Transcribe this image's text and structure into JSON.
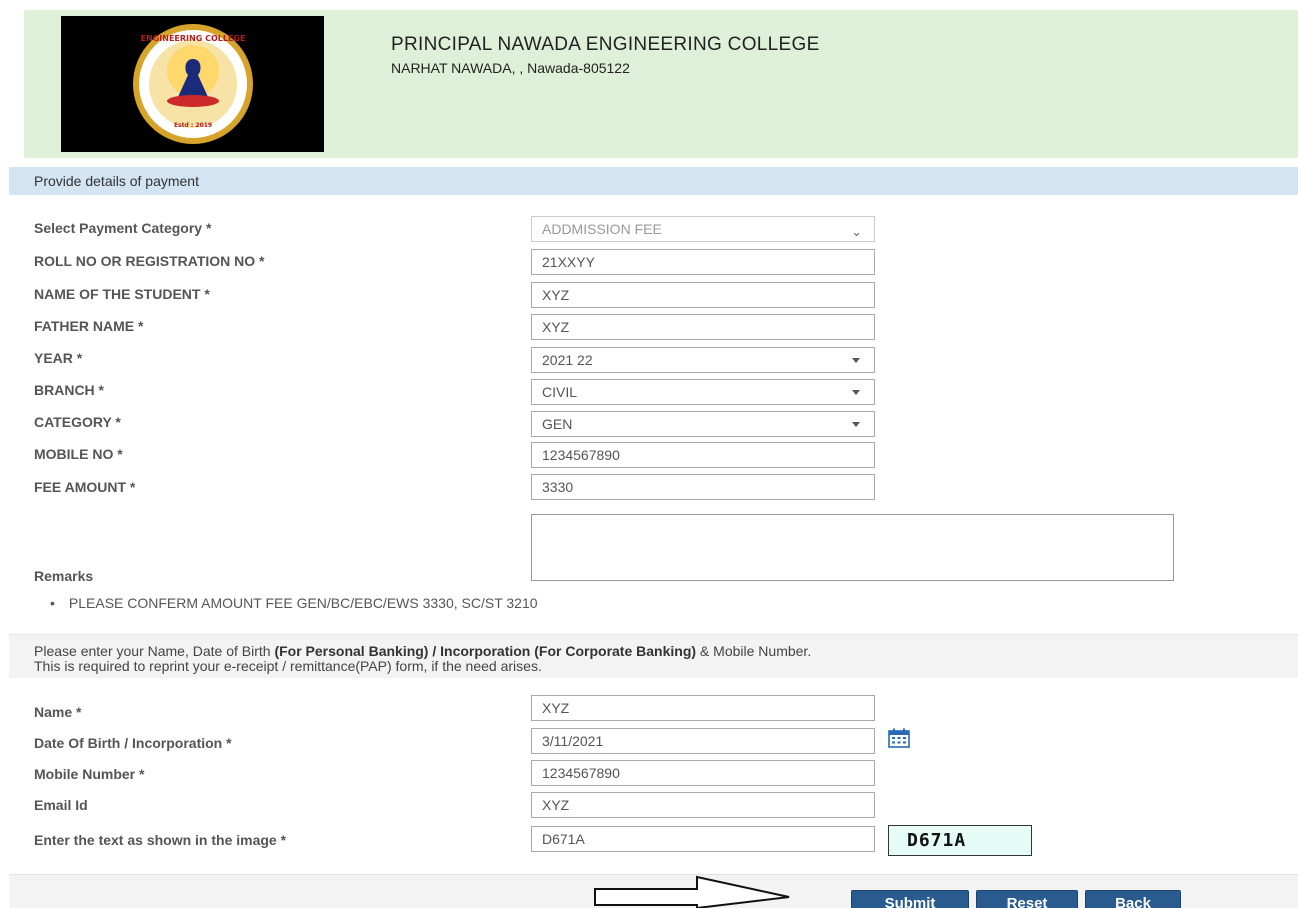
{
  "header": {
    "institution_name": "PRINCIPAL NAWADA ENGINEERING COLLEGE",
    "address": "NARHAT NAWADA, , Nawada-805122",
    "logo_texts": [
      "GOVERNMENT ENGINEERING COLLEGE NAWADA",
      "Estd : 2019"
    ]
  },
  "section_title": "Provide details of payment",
  "payment_form": {
    "category_label": "Select Payment Category *",
    "category_value": "ADDMISSION FEE",
    "roll_label": "ROLL NO OR REGISTRATION NO *",
    "roll_value": "21XXYY",
    "student_label": "NAME OF THE STUDENT *",
    "student_value": "XYZ",
    "father_label": "FATHER NAME *",
    "father_value": "XYZ",
    "year_label": "YEAR *",
    "year_value": "2021 22",
    "branch_label": "BRANCH *",
    "branch_value": "CIVIL",
    "caste_label": "CATEGORY *",
    "caste_value": "GEN",
    "mobile_label": "MOBILE NO *",
    "mobile_value": "1234567890",
    "fee_label": "FEE AMOUNT *",
    "fee_value": "3330",
    "remarks_label": "Remarks",
    "note": "PLEASE CONFERM AMOUNT FEE GEN/BC/EBC/EWS 3330, SC/ST 3210"
  },
  "info": {
    "part1": "Please enter your Name, Date of Birth ",
    "part2_bold": "(For Personal Banking) / Incorporation (For Corporate Banking)",
    "part3": " & Mobile Number.",
    "line2": "This is required to reprint your e-receipt / remittance(PAP) form, if the need arises."
  },
  "personal_form": {
    "name_label": "Name *",
    "name_value": "XYZ",
    "dob_label": "Date Of Birth / Incorporation *",
    "dob_value": "3/11/2021",
    "mobile_label": "Mobile Number *",
    "mobile_value": "1234567890",
    "email_label": "Email Id",
    "email_value": "XYZ",
    "captcha_label": "Enter the text as shown in the image *",
    "captcha_value": "D671A",
    "captcha_image_text": "D671A"
  },
  "buttons": {
    "submit": "Submit",
    "reset": "Reset",
    "back": "Back"
  },
  "icons": {
    "dropdown": "chevron-down-icon",
    "calendar": "calendar-icon",
    "arrow": "right-arrow-icon"
  }
}
